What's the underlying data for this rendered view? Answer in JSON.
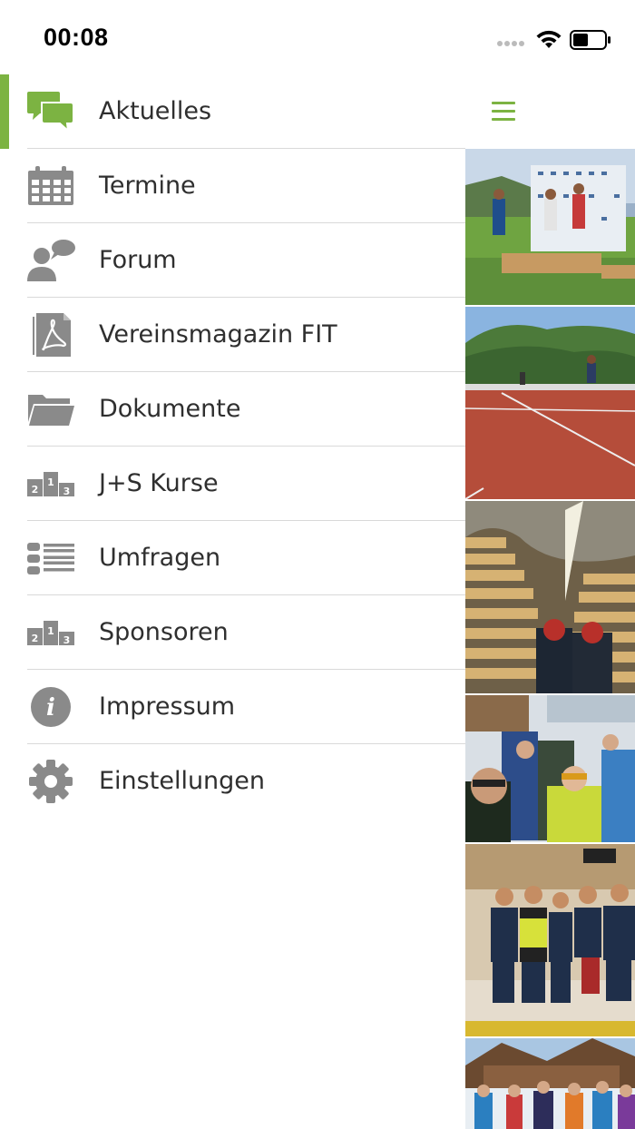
{
  "status": {
    "time": "00:08"
  },
  "menu": [
    {
      "label": "Aktuelles",
      "icon": "chat-bubbles-icon",
      "active": true
    },
    {
      "label": "Termine",
      "icon": "calendar-icon"
    },
    {
      "label": "Forum",
      "icon": "forum-user-icon"
    },
    {
      "label": "Vereinsmagazin FIT",
      "icon": "pdf-document-icon"
    },
    {
      "label": "Dokumente",
      "icon": "folder-icon"
    },
    {
      "label": "J+S Kurse",
      "icon": "podium-icon"
    },
    {
      "label": "Umfragen",
      "icon": "list-icon"
    },
    {
      "label": "Sponsoren",
      "icon": "podium-icon"
    },
    {
      "label": "Impressum",
      "icon": "info-icon"
    },
    {
      "label": "Einstellungen",
      "icon": "gear-icon"
    }
  ],
  "podium_digits": {
    "first": "1",
    "second": "2",
    "third": "3"
  },
  "info_glyph": "i",
  "colors": {
    "accent": "#7cb342",
    "icon_gray": "#8a8a8a",
    "divider": "#d9d9d9"
  }
}
